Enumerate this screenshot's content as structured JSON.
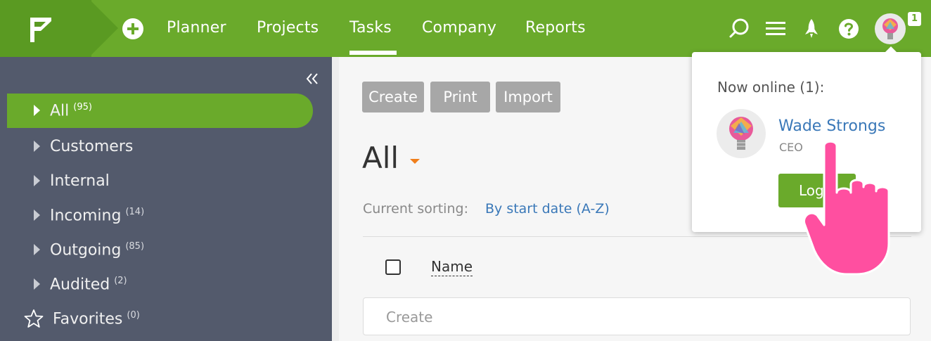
{
  "topbar": {
    "nav": [
      "Planner",
      "Projects",
      "Tasks",
      "Company",
      "Reports"
    ],
    "active_nav": "Tasks",
    "icons": [
      "logo-icon",
      "add-icon",
      "search-icon",
      "menu-icon",
      "rocket-icon",
      "help-icon",
      "avatar"
    ],
    "notification_count": "1",
    "accent": "#6aaa2b"
  },
  "sidebar": {
    "items": [
      {
        "label": "All",
        "count": "(95)",
        "active": true
      },
      {
        "label": "Customers",
        "count": ""
      },
      {
        "label": "Internal",
        "count": ""
      },
      {
        "label": "Incoming",
        "count": "(14)"
      },
      {
        "label": "Outgoing",
        "count": "(85)"
      },
      {
        "label": "Audited",
        "count": "(2)"
      },
      {
        "label": "Favorites",
        "count": "(0)"
      }
    ]
  },
  "main": {
    "buttons": [
      "Create",
      "Print",
      "Import"
    ],
    "heading": "All",
    "sorting_label": "Current sorting:",
    "sorting_value": "By start date (A-Z)",
    "column_name": "Name",
    "create_placeholder": "Create"
  },
  "popup": {
    "title": "Now online (1):",
    "user_name": "Wade Strongs",
    "user_role": "CEO",
    "logout_label": "Log"
  }
}
